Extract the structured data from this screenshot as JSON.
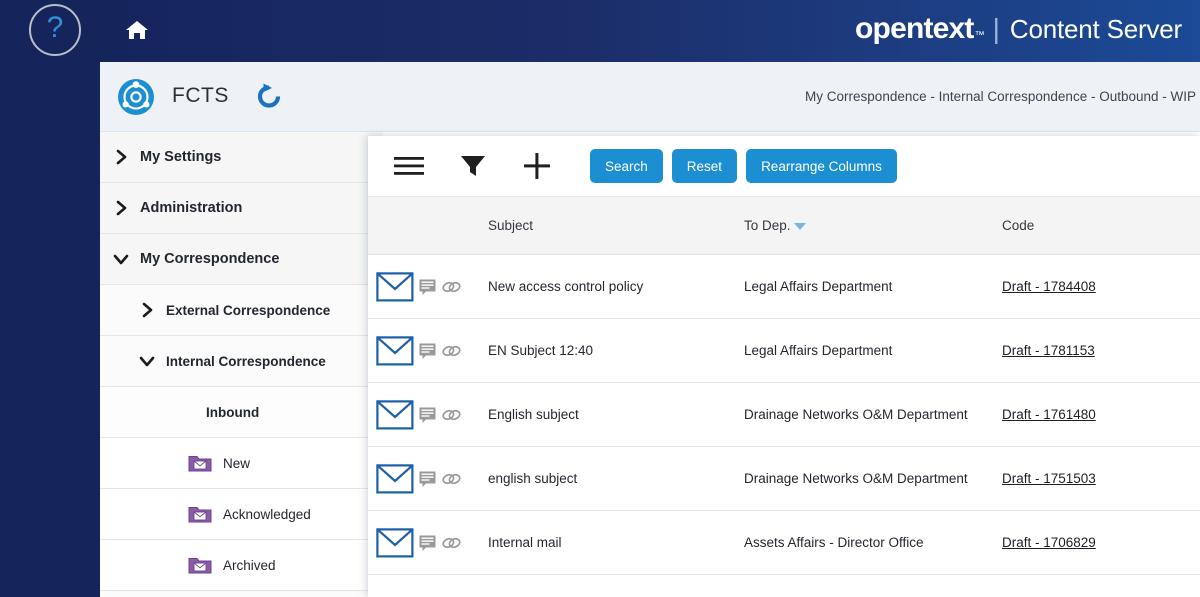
{
  "topbar": {
    "help_icon": "question-mark-icon",
    "help_label": "?",
    "home_icon": "home-icon",
    "brand_name": "opentext",
    "brand_tm": "™",
    "brand_divider": "|",
    "brand_product": "Content Server"
  },
  "app_header": {
    "logo_icon": "fcts-logo-icon",
    "title": "FCTS",
    "refresh_icon": "refresh-icon",
    "breadcrumb": "My Correspondence - Internal Correspondence - Outbound - WIP"
  },
  "sidebar": {
    "items": [
      {
        "label": "My Settings",
        "level": 0,
        "state": "collapsed",
        "icon": "chevron-right-icon"
      },
      {
        "label": "Administration",
        "level": 0,
        "state": "collapsed",
        "icon": "chevron-right-icon"
      },
      {
        "label": "My Correspondence",
        "level": 0,
        "state": "expanded",
        "icon": "chevron-down-icon"
      },
      {
        "label": "External Correspondence",
        "level": 1,
        "state": "collapsed",
        "icon": "chevron-right-icon"
      },
      {
        "label": "Internal Correspondence",
        "level": 1,
        "state": "expanded",
        "icon": "chevron-down-icon"
      },
      {
        "label": "Inbound",
        "level": 2,
        "state": "none",
        "icon": "none"
      },
      {
        "label": "New",
        "level": 3,
        "state": "none",
        "icon": "mail-folder-icon"
      },
      {
        "label": "Acknowledged",
        "level": 3,
        "state": "none",
        "icon": "mail-folder-icon"
      },
      {
        "label": "Archived",
        "level": 3,
        "state": "none",
        "icon": "mail-folder-icon"
      }
    ]
  },
  "toolbar": {
    "menu_icon": "hamburger-menu-icon",
    "filter_icon": "filter-funnel-icon",
    "add_icon": "plus-icon",
    "search_label": "Search",
    "reset_label": "Reset",
    "rearrange_label": "Rearrange Columns"
  },
  "table": {
    "columns": [
      {
        "label": "Subject",
        "sorted": false
      },
      {
        "label": "To Dep.",
        "sorted": true,
        "sort_direction": "desc",
        "sort_icon": "caret-down-icon"
      },
      {
        "label": "Code",
        "sorted": false
      }
    ],
    "rows": [
      {
        "mail_icon": "envelope-icon",
        "comment_icon": "comment-icon",
        "attachment_icon": "paperclip-icon",
        "subject": "New access control policy",
        "to_dep": "Legal Affairs Department",
        "code": "Draft - 1784408"
      },
      {
        "mail_icon": "envelope-icon",
        "comment_icon": "comment-icon",
        "attachment_icon": "paperclip-icon",
        "subject": "EN Subject 12:40",
        "to_dep": "Legal Affairs Department",
        "code": "Draft - 1781153"
      },
      {
        "mail_icon": "envelope-icon",
        "comment_icon": "comment-icon",
        "attachment_icon": "paperclip-icon",
        "subject": "English subject",
        "to_dep": "Drainage Networks O&M Department",
        "code": "Draft - 1761480"
      },
      {
        "mail_icon": "envelope-icon",
        "comment_icon": "comment-icon",
        "attachment_icon": "paperclip-icon",
        "subject": "english subject",
        "to_dep": "Drainage Networks O&M Department",
        "code": "Draft - 1751503"
      },
      {
        "mail_icon": "envelope-icon",
        "comment_icon": "comment-icon",
        "attachment_icon": "paperclip-icon",
        "subject": "Internal mail",
        "to_dep": "Assets Affairs - Director Office",
        "code": "Draft - 1706829"
      }
    ]
  },
  "colors": {
    "navy": "#16245c",
    "accent_blue": "#1b8fd1",
    "folder_purple": "#8b5ba8",
    "envelope_blue": "#1e5fa8",
    "header_gray": "#f4f4f4"
  }
}
